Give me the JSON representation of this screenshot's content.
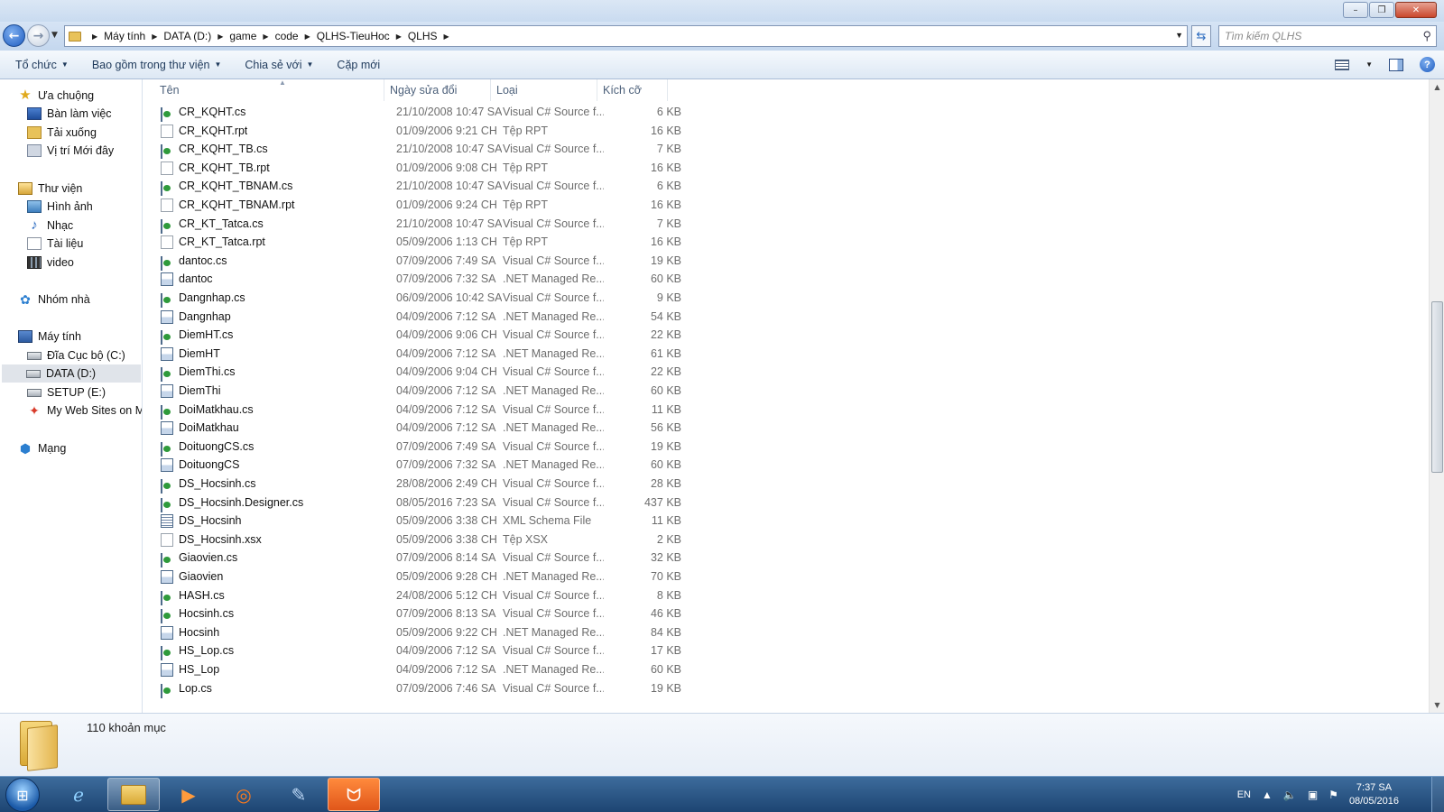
{
  "window": {
    "minimize": "–",
    "restore": "❐",
    "close": "✕"
  },
  "nav": {
    "back_glyph": "←",
    "forward_glyph": "→",
    "dropdown_glyph": "▼"
  },
  "breadcrumb": [
    "Máy tính",
    "DATA (D:)",
    "game",
    "code",
    "QLHS-TieuHoc",
    "QLHS"
  ],
  "search": {
    "placeholder": "Tìm kiếm QLHS",
    "icon": "search-icon"
  },
  "toolbar": {
    "organize": "Tổ chức",
    "include_in_library": "Bao gồm trong thư viện",
    "share_with": "Chia sẻ với",
    "new_folder": "Cặp mới"
  },
  "sidebar": {
    "favorites": "Ưa chuộng",
    "desktop": "Bàn làm việc",
    "downloads": "Tải xuống",
    "recent": "Vị trí Mới đây",
    "libraries": "Thư viện",
    "pictures": "Hình ảnh",
    "music": "Nhạc",
    "documents": "Tài liệu",
    "videos": "video",
    "homegroup": "Nhóm nhà",
    "computer": "Máy tính",
    "drive_c": "Đĩa Cục bộ (C:)",
    "drive_d": "DATA (D:)",
    "drive_e": "SETUP (E:)",
    "websites": "My Web Sites on MSN",
    "network": "Mạng"
  },
  "columns": {
    "name": "Tên",
    "date": "Ngày sửa đổi",
    "type": "Loại",
    "size": "Kích cỡ"
  },
  "files": [
    {
      "name": "CR_KQHT.cs",
      "date": "21/10/2008 10:47 SA",
      "type": "Visual C# Source f...",
      "size": "6 KB",
      "icon": "cs"
    },
    {
      "name": "CR_KQHT.rpt",
      "date": "01/09/2006 9:21 CH",
      "type": "Tệp RPT",
      "size": "16 KB",
      "icon": "blank"
    },
    {
      "name": "CR_KQHT_TB.cs",
      "date": "21/10/2008 10:47 SA",
      "type": "Visual C# Source f...",
      "size": "7 KB",
      "icon": "cs"
    },
    {
      "name": "CR_KQHT_TB.rpt",
      "date": "01/09/2006 9:08 CH",
      "type": "Tệp RPT",
      "size": "16 KB",
      "icon": "blank"
    },
    {
      "name": "CR_KQHT_TBNAM.cs",
      "date": "21/10/2008 10:47 SA",
      "type": "Visual C# Source f...",
      "size": "6 KB",
      "icon": "cs"
    },
    {
      "name": "CR_KQHT_TBNAM.rpt",
      "date": "01/09/2006 9:24 CH",
      "type": "Tệp RPT",
      "size": "16 KB",
      "icon": "blank"
    },
    {
      "name": "CR_KT_Tatca.cs",
      "date": "21/10/2008 10:47 SA",
      "type": "Visual C# Source f...",
      "size": "7 KB",
      "icon": "cs"
    },
    {
      "name": "CR_KT_Tatca.rpt",
      "date": "05/09/2006 1:13 CH",
      "type": "Tệp RPT",
      "size": "16 KB",
      "icon": "blank"
    },
    {
      "name": "dantoc.cs",
      "date": "07/09/2006 7:49 SA",
      "type": "Visual C# Source f...",
      "size": "19 KB",
      "icon": "cs"
    },
    {
      "name": "dantoc",
      "date": "07/09/2006 7:32 SA",
      "type": ".NET Managed Re...",
      "size": "60 KB",
      "icon": "resx"
    },
    {
      "name": "Dangnhap.cs",
      "date": "06/09/2006 10:42 SA",
      "type": "Visual C# Source f...",
      "size": "9 KB",
      "icon": "cs"
    },
    {
      "name": "Dangnhap",
      "date": "04/09/2006 7:12 SA",
      "type": ".NET Managed Re...",
      "size": "54 KB",
      "icon": "resx"
    },
    {
      "name": "DiemHT.cs",
      "date": "04/09/2006 9:06 CH",
      "type": "Visual C# Source f...",
      "size": "22 KB",
      "icon": "cs"
    },
    {
      "name": "DiemHT",
      "date": "04/09/2006 7:12 SA",
      "type": ".NET Managed Re...",
      "size": "61 KB",
      "icon": "resx"
    },
    {
      "name": "DiemThi.cs",
      "date": "04/09/2006 9:04 CH",
      "type": "Visual C# Source f...",
      "size": "22 KB",
      "icon": "cs"
    },
    {
      "name": "DiemThi",
      "date": "04/09/2006 7:12 SA",
      "type": ".NET Managed Re...",
      "size": "60 KB",
      "icon": "resx"
    },
    {
      "name": "DoiMatkhau.cs",
      "date": "04/09/2006 7:12 SA",
      "type": "Visual C# Source f...",
      "size": "11 KB",
      "icon": "cs"
    },
    {
      "name": "DoiMatkhau",
      "date": "04/09/2006 7:12 SA",
      "type": ".NET Managed Re...",
      "size": "56 KB",
      "icon": "resx"
    },
    {
      "name": "DoituongCS.cs",
      "date": "07/09/2006 7:49 SA",
      "type": "Visual C# Source f...",
      "size": "19 KB",
      "icon": "cs"
    },
    {
      "name": "DoituongCS",
      "date": "07/09/2006 7:32 SA",
      "type": ".NET Managed Re...",
      "size": "60 KB",
      "icon": "resx"
    },
    {
      "name": "DS_Hocsinh.cs",
      "date": "28/08/2006 2:49 CH",
      "type": "Visual C# Source f...",
      "size": "28 KB",
      "icon": "cs"
    },
    {
      "name": "DS_Hocsinh.Designer.cs",
      "date": "08/05/2016 7:23 SA",
      "type": "Visual C# Source f...",
      "size": "437 KB",
      "icon": "cs"
    },
    {
      "name": "DS_Hocsinh",
      "date": "05/09/2006 3:38 CH",
      "type": "XML Schema File",
      "size": "11 KB",
      "icon": "xsd"
    },
    {
      "name": "DS_Hocsinh.xsx",
      "date": "05/09/2006 3:38 CH",
      "type": "Tệp XSX",
      "size": "2 KB",
      "icon": "blank"
    },
    {
      "name": "Giaovien.cs",
      "date": "07/09/2006 8:14 SA",
      "type": "Visual C# Source f...",
      "size": "32 KB",
      "icon": "cs"
    },
    {
      "name": "Giaovien",
      "date": "05/09/2006 9:28 CH",
      "type": ".NET Managed Re...",
      "size": "70 KB",
      "icon": "resx"
    },
    {
      "name": "HASH.cs",
      "date": "24/08/2006 5:12 CH",
      "type": "Visual C# Source f...",
      "size": "8 KB",
      "icon": "cs"
    },
    {
      "name": "Hocsinh.cs",
      "date": "07/09/2006 8:13 SA",
      "type": "Visual C# Source f...",
      "size": "46 KB",
      "icon": "cs"
    },
    {
      "name": "Hocsinh",
      "date": "05/09/2006 9:22 CH",
      "type": ".NET Managed Re...",
      "size": "84 KB",
      "icon": "resx"
    },
    {
      "name": "HS_Lop.cs",
      "date": "04/09/2006 7:12 SA",
      "type": "Visual C# Source f...",
      "size": "17 KB",
      "icon": "cs"
    },
    {
      "name": "HS_Lop",
      "date": "04/09/2006 7:12 SA",
      "type": ".NET Managed Re...",
      "size": "60 KB",
      "icon": "resx"
    },
    {
      "name": "Lop.cs",
      "date": "07/09/2006 7:46 SA",
      "type": "Visual C# Source f...",
      "size": "19 KB",
      "icon": "cs"
    }
  ],
  "details": {
    "item_count": "110 khoản mục"
  },
  "taskbar": {
    "lang": "EN",
    "time": "7:37 SA",
    "date": "08/05/2016",
    "apps": [
      "internet-explorer-icon",
      "file-explorer-icon",
      "media-player-icon",
      "browser-icon",
      "tool-icon",
      "uc-browser-icon"
    ]
  },
  "colors": {
    "accent": "#1d5bc0",
    "taskbar": "#1d4572",
    "selected_nav": "#e0e4ea"
  }
}
